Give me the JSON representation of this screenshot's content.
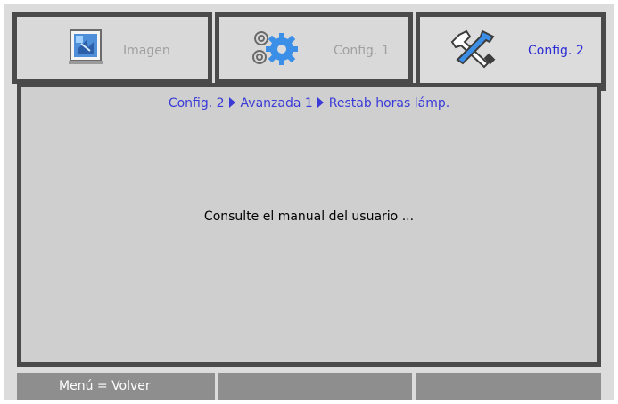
{
  "tabs": [
    {
      "label": "Imagen",
      "icon": "picture-icon",
      "active": false
    },
    {
      "label": "Config. 1",
      "icon": "gears-icon",
      "active": false
    },
    {
      "label": "Config. 2",
      "icon": "tools-icon",
      "active": true
    }
  ],
  "breadcrumb": {
    "items": [
      "Config. 2",
      "Avanzada 1",
      "Restab horas lámp."
    ]
  },
  "message": "Consulte el manual del usuario ...",
  "footer": {
    "back_hint": "Menú = Volver",
    "cell2": "",
    "cell3": ""
  },
  "colors": {
    "active_text": "#2b2bd6",
    "inactive_text": "#a0a0a0",
    "panel_bg": "#cfcfcf",
    "border": "#4a4a4a",
    "footer_bg": "#8e8e8e"
  }
}
